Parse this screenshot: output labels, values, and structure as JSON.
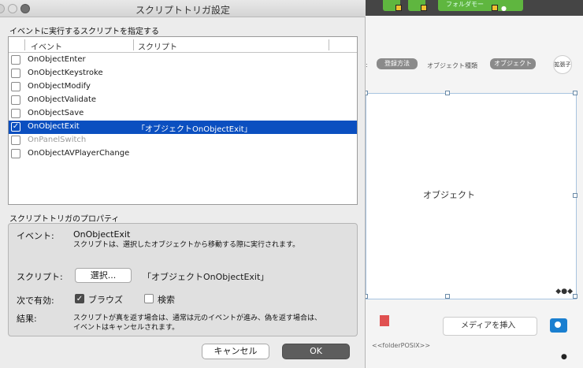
{
  "dialog": {
    "title": "スクリプトトリガ設定",
    "list_section_label": "イベントに実行するスクリプトを指定する",
    "columns": {
      "event": "イベント",
      "script": "スクリプト"
    },
    "rows": [
      {
        "event": "OnObjectEnter",
        "script": "",
        "checked": false,
        "selected": false,
        "disabled": false
      },
      {
        "event": "OnObjectKeystroke",
        "script": "",
        "checked": false,
        "selected": false,
        "disabled": false
      },
      {
        "event": "OnObjectModify",
        "script": "",
        "checked": false,
        "selected": false,
        "disabled": false
      },
      {
        "event": "OnObjectValidate",
        "script": "",
        "checked": false,
        "selected": false,
        "disabled": false
      },
      {
        "event": "OnObjectSave",
        "script": "",
        "checked": false,
        "selected": false,
        "disabled": false
      },
      {
        "event": "OnObjectExit",
        "script": "「オブジェクトOnObjectExit」",
        "checked": true,
        "selected": true,
        "disabled": false
      },
      {
        "event": "OnPanelSwitch",
        "script": "",
        "checked": false,
        "selected": false,
        "disabled": true
      },
      {
        "event": "OnObjectAVPlayerChange",
        "script": "",
        "checked": false,
        "selected": false,
        "disabled": false
      }
    ],
    "properties": {
      "section_label": "スクリプトトリガのプロパティ",
      "event_label": "イベント:",
      "event_value": "OnObjectExit",
      "event_desc": "スクリプトは、選択したオブジェクトから移動する際に実行されます。",
      "script_label": "スクリプト:",
      "select_button": "選択...",
      "script_value": "「オブジェクトOnObjectExit」",
      "enabled_label": "次で有効:",
      "browse_label": "ブラウズ",
      "browse_checked": true,
      "find_label": "検索",
      "find_checked": false,
      "result_label": "結果:",
      "result_desc_1": "スクリプトが真を返す場合は、通常は元のイベントが進み、偽を返す場合は、",
      "result_desc_2": "イベントはキャンセルされます。"
    },
    "cancel_button": "キャンセル",
    "ok_button": "OK"
  },
  "background": {
    "toolbar_label": "フォルダモー",
    "pill_1": "登録方法",
    "field_label": "オブジェクト種類",
    "pill_2": "オブジェクト",
    "circle_label": "拡張子",
    "object_label": "オブジェクト",
    "media_button": "メディアを挿入",
    "folder_text": "<<folderPOSIX>>"
  }
}
